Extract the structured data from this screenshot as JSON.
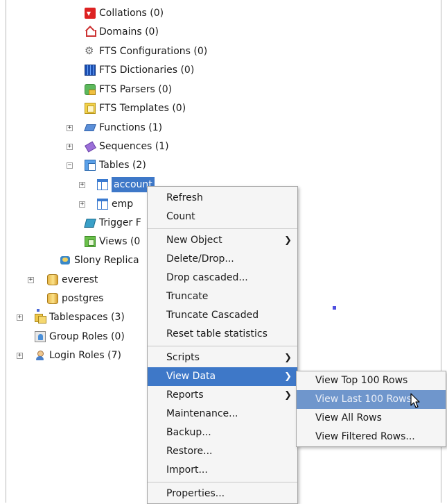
{
  "tree": {
    "items": [
      {
        "label": "Collations (0)",
        "icon": "collation-icon"
      },
      {
        "label": "Domains (0)",
        "icon": "domain-icon"
      },
      {
        "label": "FTS Configurations (0)",
        "icon": "fts-configuration-icon"
      },
      {
        "label": "FTS Dictionaries (0)",
        "icon": "fts-dictionary-icon"
      },
      {
        "label": "FTS Parsers (0)",
        "icon": "fts-parser-icon"
      },
      {
        "label": "FTS Templates (0)",
        "icon": "fts-template-icon"
      },
      {
        "label": "Functions (1)",
        "icon": "function-icon",
        "expander": "+"
      },
      {
        "label": "Sequences (1)",
        "icon": "sequence-icon",
        "expander": "+"
      },
      {
        "label": "Tables (2)",
        "icon": "tables-icon",
        "expander": "−"
      },
      {
        "label": "account",
        "icon": "table-icon",
        "expander": "+",
        "selected": true
      },
      {
        "label": "emp",
        "icon": "table-icon",
        "expander": "+"
      },
      {
        "label": "Trigger F",
        "icon": "trigger-function-icon"
      },
      {
        "label": "Views (0",
        "icon": "view-icon"
      },
      {
        "label": "Slony Replica",
        "icon": "slony-icon"
      },
      {
        "label": "everest",
        "icon": "database-icon",
        "expander": "+"
      },
      {
        "label": "postgres",
        "icon": "database-icon"
      },
      {
        "label": "Tablespaces (3)",
        "icon": "tablespace-icon",
        "expander": "+"
      },
      {
        "label": "Group Roles (0)",
        "icon": "group-roles-icon"
      },
      {
        "label": "Login Roles (7)",
        "icon": "login-roles-icon",
        "expander": "+"
      }
    ]
  },
  "context_menu": {
    "items": [
      {
        "label": "Refresh"
      },
      {
        "label": "Count"
      },
      {
        "label": "New Object",
        "submenu": true
      },
      {
        "label": "Delete/Drop..."
      },
      {
        "label": "Drop cascaded..."
      },
      {
        "label": "Truncate"
      },
      {
        "label": "Truncate Cascaded"
      },
      {
        "label": "Reset table statistics"
      },
      {
        "label": "Scripts",
        "submenu": true
      },
      {
        "label": "View Data",
        "submenu": true,
        "active": true
      },
      {
        "label": "Reports",
        "submenu": true
      },
      {
        "label": "Maintenance..."
      },
      {
        "label": "Backup..."
      },
      {
        "label": "Restore..."
      },
      {
        "label": "Import..."
      },
      {
        "label": "Properties..."
      }
    ],
    "submenu_arrow": "❯"
  },
  "view_data_submenu": {
    "items": [
      {
        "label": "View Top 100 Rows"
      },
      {
        "label": "View Last 100 Rows",
        "hover": true
      },
      {
        "label": "View All Rows"
      },
      {
        "label": "View Filtered Rows..."
      }
    ]
  },
  "colors": {
    "selection": "#3e78c8",
    "hover": "#6f96cc",
    "menu_bg": "#f5f5f5"
  }
}
